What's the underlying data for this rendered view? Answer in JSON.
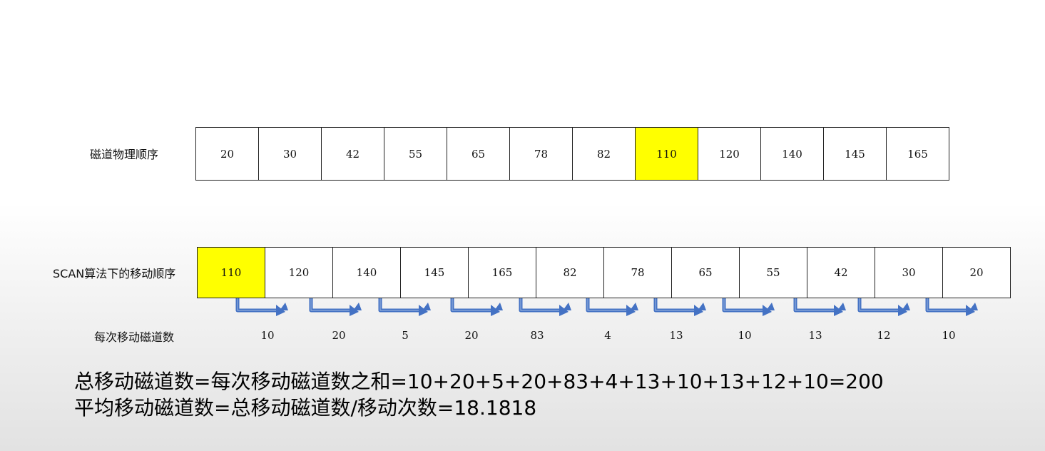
{
  "physical_order": {
    "label": "磁道物理顺序",
    "cells": [
      {
        "value": "20",
        "highlight": false
      },
      {
        "value": "30",
        "highlight": false
      },
      {
        "value": "42",
        "highlight": false
      },
      {
        "value": "55",
        "highlight": false
      },
      {
        "value": "65",
        "highlight": false
      },
      {
        "value": "78",
        "highlight": false
      },
      {
        "value": "82",
        "highlight": false
      },
      {
        "value": "110",
        "highlight": true
      },
      {
        "value": "120",
        "highlight": false
      },
      {
        "value": "140",
        "highlight": false
      },
      {
        "value": "145",
        "highlight": false
      },
      {
        "value": "165",
        "highlight": false
      }
    ]
  },
  "scan_order": {
    "label": "SCAN算法下的移动顺序",
    "cells": [
      {
        "value": "110",
        "highlight": true
      },
      {
        "value": "120",
        "highlight": false
      },
      {
        "value": "140",
        "highlight": false
      },
      {
        "value": "145",
        "highlight": false
      },
      {
        "value": "165",
        "highlight": false
      },
      {
        "value": "82",
        "highlight": false
      },
      {
        "value": "78",
        "highlight": false
      },
      {
        "value": "65",
        "highlight": false
      },
      {
        "value": "55",
        "highlight": false
      },
      {
        "value": "42",
        "highlight": false
      },
      {
        "value": "30",
        "highlight": false
      },
      {
        "value": "20",
        "highlight": false
      }
    ]
  },
  "moves": {
    "label": "每次移动磁道数",
    "values": [
      "10",
      "20",
      "5",
      "20",
      "83",
      "4",
      "13",
      "10",
      "13",
      "12",
      "10"
    ]
  },
  "summary": {
    "line1": "总移动磁道数=每次移动磁道数之和=10+20+5+20+83+4+13+10+13+12+10=200",
    "line2": "平均移动磁道数=总移动磁道数/移动次数=18.1818"
  },
  "colors": {
    "highlight": "#ffff00",
    "arrow": "#4472c4"
  }
}
